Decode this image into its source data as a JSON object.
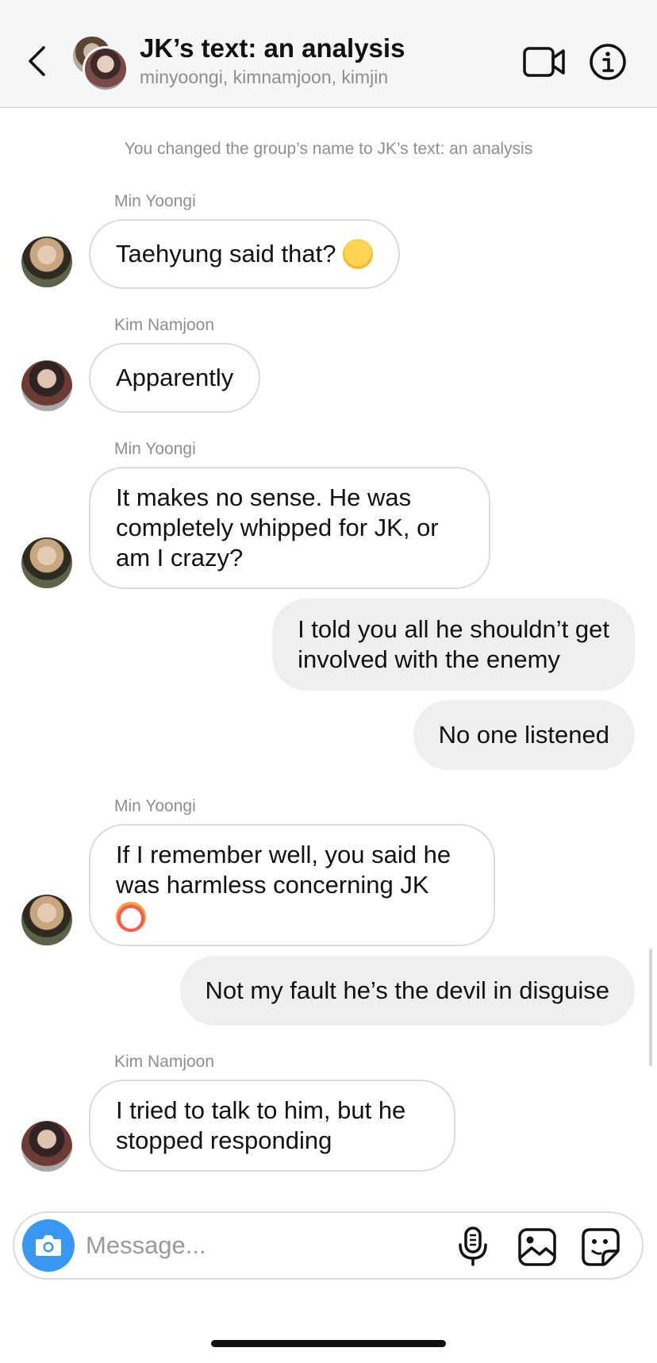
{
  "header": {
    "title": "JK’s text: an analysis",
    "members": "minyoongi, kimnamjoon, kimjin",
    "icons": [
      "back-icon",
      "group-avatar",
      "video-camera-icon",
      "info-icon"
    ]
  },
  "system_message": "You changed the group’s name to JK’s text: an analysis",
  "messages": [
    {
      "sender": "Min Yoongi",
      "direction": "in",
      "lines": [
        "Taehyung said that?"
      ],
      "emoji": "thinking-face"
    },
    {
      "sender": "Kim Namjoon",
      "direction": "in",
      "lines": [
        "Apparently"
      ]
    },
    {
      "sender": "Min Yoongi",
      "direction": "in",
      "lines": [
        "It makes no sense. He was",
        "completely whipped for JK, or",
        "am I crazy?"
      ]
    },
    {
      "direction": "out",
      "lines": [
        "I told you all he shouldn’t get",
        "involved with the enemy"
      ]
    },
    {
      "direction": "out",
      "lines": [
        "No one listened"
      ]
    },
    {
      "sender": "Min Yoongi",
      "direction": "in",
      "lines": [
        "If I remember well, you said he",
        "was harmless concerning JK"
      ],
      "emoji": "clown-face"
    },
    {
      "direction": "out",
      "lines": [
        "Not my fault he’s the devil in disguise"
      ]
    },
    {
      "sender": "Kim Namjoon",
      "direction": "in",
      "lines": [
        "I tried to talk to him, but he",
        "stopped responding"
      ]
    }
  ],
  "composer": {
    "placeholder": "Message...",
    "value": "",
    "icons": [
      "camera-icon",
      "microphone-icon",
      "gallery-icon",
      "sticker-icon"
    ]
  },
  "colors": {
    "header_bg": "#f6f6f6",
    "incoming_border": "#dbdbdb",
    "outgoing_bg": "#efefef",
    "camera_button": "#3897f0",
    "secondary_text": "#8e8e8e"
  }
}
